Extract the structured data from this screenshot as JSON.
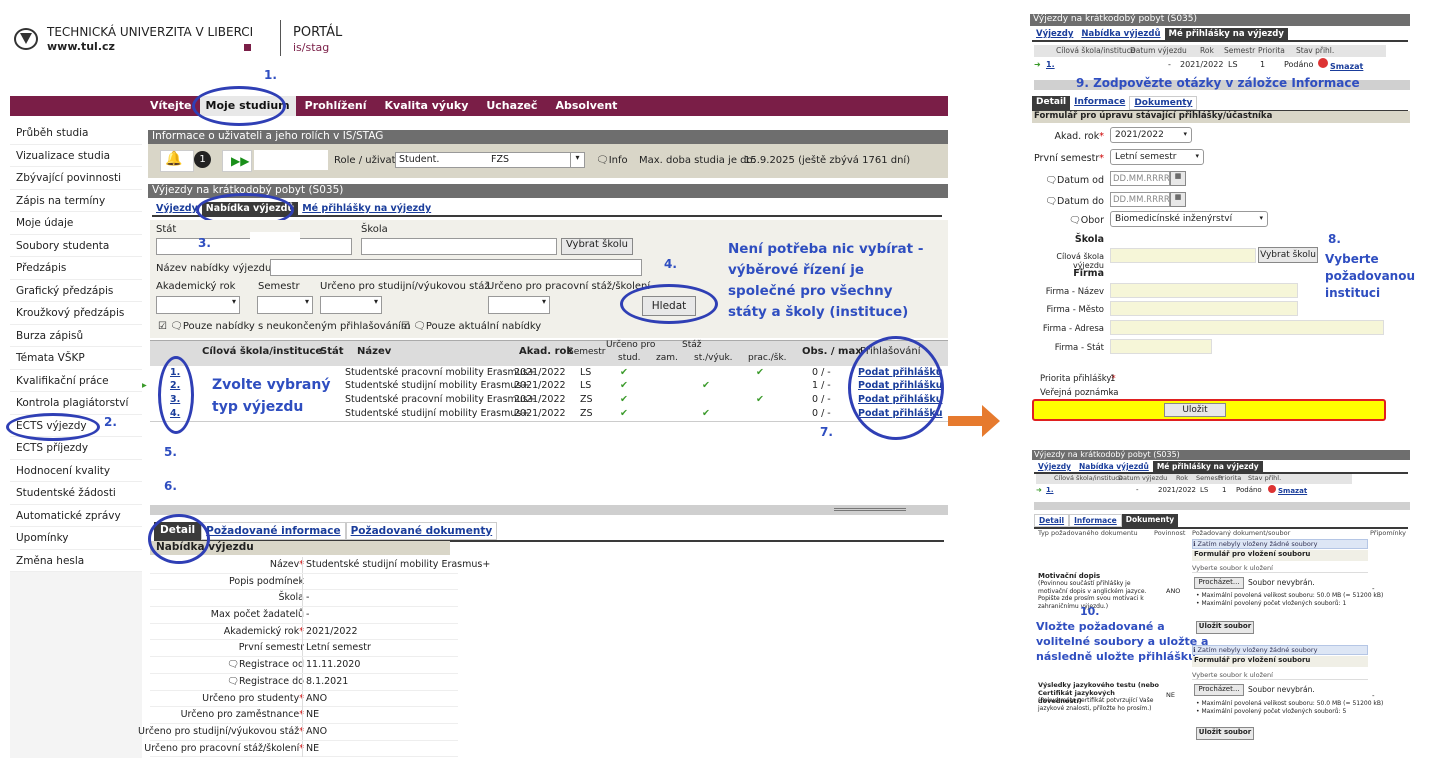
{
  "header": {
    "university": "TECHNICKÁ UNIVERZITA V LIBERCI",
    "web": "www.tul.cz",
    "portal": "PORTÁL",
    "portal_sub": "is/stag"
  },
  "nav": [
    "Vítejte",
    "Moje studium",
    "Prohlížení",
    "Kvalita výuky",
    "Uchazeč",
    "Absolvent"
  ],
  "sidebar": [
    "Průběh studia",
    "Vizualizace studia",
    "Zbývající povinnosti",
    "Zápis na termíny",
    "Moje údaje",
    "Soubory studenta",
    "Předzápis",
    "Grafický předzápis",
    "Kroužkový předzápis",
    "Burza zápisů",
    "Témata VŠKP",
    "Kvalifikační práce",
    "Kontrola plagiátorství",
    "ECTS výjezdy",
    "ECTS příjezdy",
    "Hodnocení kvality",
    "Studentské žádosti",
    "Automatické zprávy",
    "Upomínky",
    "Změna hesla"
  ],
  "info": {
    "title": "Informace o uživateli a jeho rolích v IS/STAG",
    "badge": "1",
    "role_label": "Role / uživatel",
    "role_value": "Student.",
    "faculty": "FZS",
    "info_label": "Info",
    "max_label": "Max. doba studia je do:",
    "max_value": "15.9.2025 (ještě zbývá 1761 dní)"
  },
  "trips": {
    "title": "Výjezdy na krátkodobý pobyt (S035)",
    "tabs": [
      "Výjezdy",
      "Nabídka výjezdů",
      "Mé přihlášky na výjezdy"
    ],
    "stat": "Stát",
    "skola": "Škola",
    "vybrat": "Vybrat školu",
    "nazev": "Název nabídky výjezdu",
    "rok": "Akademický rok",
    "semestr": "Semestr",
    "urceno_stud": "Určeno pro studijní/výukovou stáž",
    "urceno_prac": "Určeno pro pracovní stáž/školení",
    "hledat": "Hledat",
    "cb1": "Pouze nabídky s neukončeným přihlašováním",
    "cb2": "Pouze aktuální nabídky"
  },
  "table": {
    "headers": [
      "Cílová škola/instituce",
      "Stát",
      "Název",
      "Akad. rok",
      "Semestr",
      "Určeno pro",
      "stud.",
      "zam.",
      "Stáž",
      "st./výuk.",
      "prac./šk.",
      "Obs. / max",
      "Přihlašování"
    ],
    "rows": [
      {
        "n": "1.",
        "name": "Studentské pracovní mobility Erasmus+",
        "year": "2021/2022",
        "sem": "LS",
        "obs": "0 / -",
        "act": "Podat přihlášku"
      },
      {
        "n": "2.",
        "name": "Studentské studijní mobility Erasmus+",
        "year": "2021/2022",
        "sem": "LS",
        "obs": "1 / -",
        "act": "Podat přihlášku"
      },
      {
        "n": "3.",
        "name": "Studentské pracovní mobility Erasmus+",
        "year": "2021/2022",
        "sem": "ZS",
        "obs": "0 / -",
        "act": "Podat přihlášku"
      },
      {
        "n": "4.",
        "name": "Studentské studijní mobility Erasmus+",
        "year": "2021/2022",
        "sem": "ZS",
        "obs": "0 / -",
        "act": "Podat přihlášku"
      }
    ]
  },
  "detail": {
    "tabs": [
      "Detail",
      "Požadované informace",
      "Požadované dokumenty"
    ],
    "section": "Nabídka výjezdu",
    "fields": [
      {
        "l": "Název",
        "v": "Studentské studijní mobility Erasmus+"
      },
      {
        "l": "Popis podmínek",
        "v": ""
      },
      {
        "l": "Škola",
        "v": "-"
      },
      {
        "l": "Max počet žadatelů",
        "v": "-"
      },
      {
        "l": "Akademický rok",
        "v": "2021/2022"
      },
      {
        "l": "První semestr",
        "v": "Letní semestr"
      },
      {
        "l": "Registrace od",
        "v": "11.11.2020"
      },
      {
        "l": "Registrace do",
        "v": "8.1.2021"
      },
      {
        "l": "Určeno pro studenty",
        "v": "ANO"
      },
      {
        "l": "Určeno pro zaměstnance",
        "v": "NE"
      },
      {
        "l": "Určeno pro studijní/výukovou stáž",
        "v": "ANO"
      },
      {
        "l": "Určeno pro pracovní stáž/školení",
        "v": "NE"
      }
    ]
  },
  "notes": {
    "n1": "1.",
    "n2": "2.",
    "n3": "3.",
    "n4": "4.",
    "n5": "5.",
    "n6": "6.",
    "n7": "7.",
    "n8": "8.",
    "n9": "9.",
    "n10": "10.",
    "note4": "Není potřeba nic vybírat -\nvýběrové řízení je\nspolečné pro všechny\nstáty a školy (instituce)",
    "zvolte": "Zvolte vybraný\ntyp výjezdu",
    "note8": "Vyberte\npožadovanou\ninstituci",
    "note9": "Zodpovězte otázky v záložce Informace",
    "note10": "Vložte požadované a\nvolitelné soubory a uložte a\nnásledně uložte přihlášku"
  },
  "right1": {
    "title": "Výjezdy na krátkodobý pobyt (S035)",
    "tabs": [
      "Výjezdy",
      "Nabídka výjezdů",
      "Mé přihlášky na výjezdy"
    ],
    "cols": [
      "Cílová škola/instituce",
      "Datum výjezdu",
      "Rok",
      "Semestr",
      "Priorita",
      "Stav přihl."
    ],
    "row": {
      "n": "1.",
      "d": "-",
      "rok": "2021/2022",
      "sem": "LS",
      "pri": "1",
      "stav": "Podáno",
      "del": "Smazat"
    },
    "subtabs": [
      "Detail",
      "Informace",
      "Dokumenty"
    ],
    "form_title": "Formulář pro úpravu stávající přihlášky/účastníka",
    "akad_l": "Akad. rok",
    "akad_v": "2021/2022",
    "sem_l": "První semestr",
    "sem_v": "Letní semestr",
    "od_l": "Datum od",
    "do_l": "Datum do",
    "date_ph": "DD.MM.RRRR",
    "obor_l": "Obor",
    "obor_v": "Biomedicínské inženýrství",
    "skola_h": "Škola",
    "cil_l": "Cílová škola výjezdu",
    "vyb": "Vybrat školu",
    "firma_h": "Firma",
    "f1": "Firma - Název",
    "f2": "Firma - Město",
    "f3": "Firma - Adresa",
    "f4": "Firma - Stát",
    "pri_l": "Priorita přihlášky",
    "pri_v": "1",
    "pozn_l": "Veřejná poznámka",
    "pozn_v": "-",
    "ulozit": "Uložit"
  },
  "right2": {
    "title": "Výjezdy na krátkodobý pobyt (S035)",
    "doc_cols": [
      "Typ požadovaného dokumentu",
      "Povinnost",
      "Požadovaný dokument/soubor",
      "Připomínky"
    ],
    "none": "Zatím nebyly vloženy žádné soubory",
    "form": "Formulář pro vložení souboru",
    "choose": "Vyberte soubor k uložení",
    "browse": "Procházet...",
    "nofile": "Soubor nevybrán.",
    "save": "Uložit soubor",
    "doc1": "Motivační dopis",
    "doc1_desc": "(Povinnou součástí přihlášky je motivační dopis v anglickém jazyce. Popište zde prosím svou motivaci k zahraničnímu výjezdu.)",
    "doc1_req": "ANO",
    "doc1_i1": "• Maximální povolená velikost souboru: 50.0 MB (= 51200 kB)",
    "doc1_i2": "• Maximální povolený počet vložených souborů: 1",
    "doc2": "Výsledky jazykového testu (nebo Certifikát jazykových dovedností)",
    "doc2_desc": "(Pokud máte certifikát potvrzující Vaše jazykové znalosti, přiložte ho prosím.)",
    "doc2_req": "NE",
    "doc2_i2": "• Maximální povolený počet vložených souborů: 5",
    "dash": "-"
  }
}
